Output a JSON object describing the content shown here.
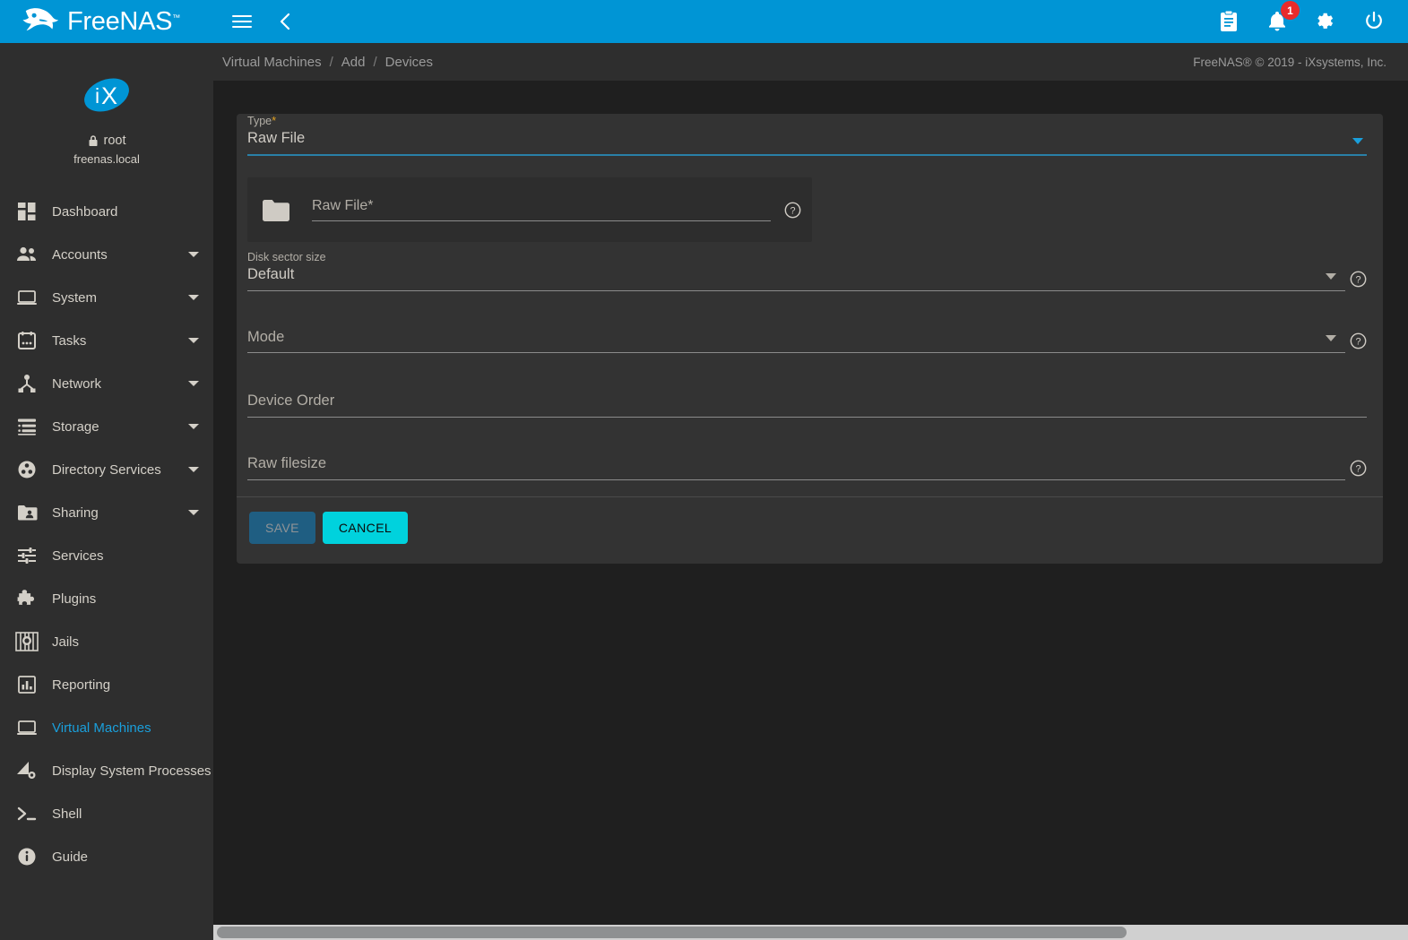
{
  "topbar": {
    "brand_name": "FreeNAS",
    "brand_tm": "™",
    "logo_icon": "freenas-fish-logo",
    "menu_icon": "hamburger-menu-icon",
    "back_icon": "chevron-left-icon",
    "tasks_icon": "clipboard-icon",
    "notifications_icon": "bell-icon",
    "notifications_count": "1",
    "settings_icon": "gear-icon",
    "power_icon": "power-icon"
  },
  "sidebar": {
    "logo_icon": "ix-systems-logo",
    "logo_text": "iX",
    "lock_icon": "lock-icon",
    "username": "root",
    "hostname": "freenas.local",
    "items": [
      {
        "label": "Dashboard",
        "icon": "dashboard-icon",
        "expandable": false,
        "active": false
      },
      {
        "label": "Accounts",
        "icon": "people-icon",
        "expandable": true,
        "active": false
      },
      {
        "label": "System",
        "icon": "laptop-icon",
        "expandable": true,
        "active": false
      },
      {
        "label": "Tasks",
        "icon": "calendar-icon",
        "expandable": true,
        "active": false
      },
      {
        "label": "Network",
        "icon": "network-nodes-icon",
        "expandable": true,
        "active": false
      },
      {
        "label": "Storage",
        "icon": "storage-list-icon",
        "expandable": true,
        "active": false
      },
      {
        "label": "Directory Services",
        "icon": "directory-services-icon",
        "expandable": true,
        "active": false
      },
      {
        "label": "Sharing",
        "icon": "sharing-folder-icon",
        "expandable": true,
        "active": false
      },
      {
        "label": "Services",
        "icon": "sliders-icon",
        "expandable": false,
        "active": false
      },
      {
        "label": "Plugins",
        "icon": "puzzle-piece-icon",
        "expandable": false,
        "active": false
      },
      {
        "label": "Jails",
        "icon": "jails-icon",
        "expandable": false,
        "active": false
      },
      {
        "label": "Reporting",
        "icon": "bar-chart-icon",
        "expandable": false,
        "active": false
      },
      {
        "label": "Virtual Machines",
        "icon": "monitor-icon",
        "expandable": false,
        "active": true
      },
      {
        "label": "Display System Processes",
        "icon": "processes-icon",
        "expandable": false,
        "active": false
      },
      {
        "label": "Shell",
        "icon": "terminal-icon",
        "expandable": false,
        "active": false
      },
      {
        "label": "Guide",
        "icon": "info-circle-icon",
        "expandable": false,
        "active": false
      }
    ]
  },
  "breadcrumb": {
    "items": [
      "Virtual Machines",
      "Add",
      "Devices"
    ],
    "separator": "/",
    "copyright": "FreeNAS® © 2019 - iXsystems, Inc."
  },
  "form": {
    "type_field": {
      "label": "Type",
      "required_marker": "*",
      "value": "Raw File",
      "caret_icon": "chevron-down-icon"
    },
    "raw_file_picker": {
      "folder_icon": "folder-icon",
      "label": "Raw File",
      "required_marker": "*",
      "value": "",
      "help_icon": "help-circle-icon"
    },
    "disk_sector_size": {
      "label": "Disk sector size",
      "value": "Default",
      "caret_icon": "chevron-down-icon",
      "help_icon": "help-circle-icon"
    },
    "mode": {
      "label": "Mode",
      "value": "",
      "caret_icon": "chevron-down-icon",
      "help_icon": "help-circle-icon"
    },
    "device_order": {
      "label": "Device Order",
      "value": ""
    },
    "raw_filesize": {
      "label": "Raw filesize",
      "value": "",
      "help_icon": "help-circle-icon"
    },
    "save_label": "SAVE",
    "cancel_label": "CANCEL"
  },
  "colors": {
    "accent_blue": "#0095d5",
    "active_link": "#1a9fdb",
    "cancel_cyan": "#00d2dd",
    "save_disabled": "#1f5e82",
    "badge_red": "#e82b2b",
    "required_star": "#e0a124",
    "sidebar_bg": "#2e2e2e",
    "main_bg": "#1f1f1f",
    "card_bg": "#333333"
  },
  "scrollbar": {
    "orientation": "horizontal",
    "name": "horizontal-scrollbar"
  }
}
